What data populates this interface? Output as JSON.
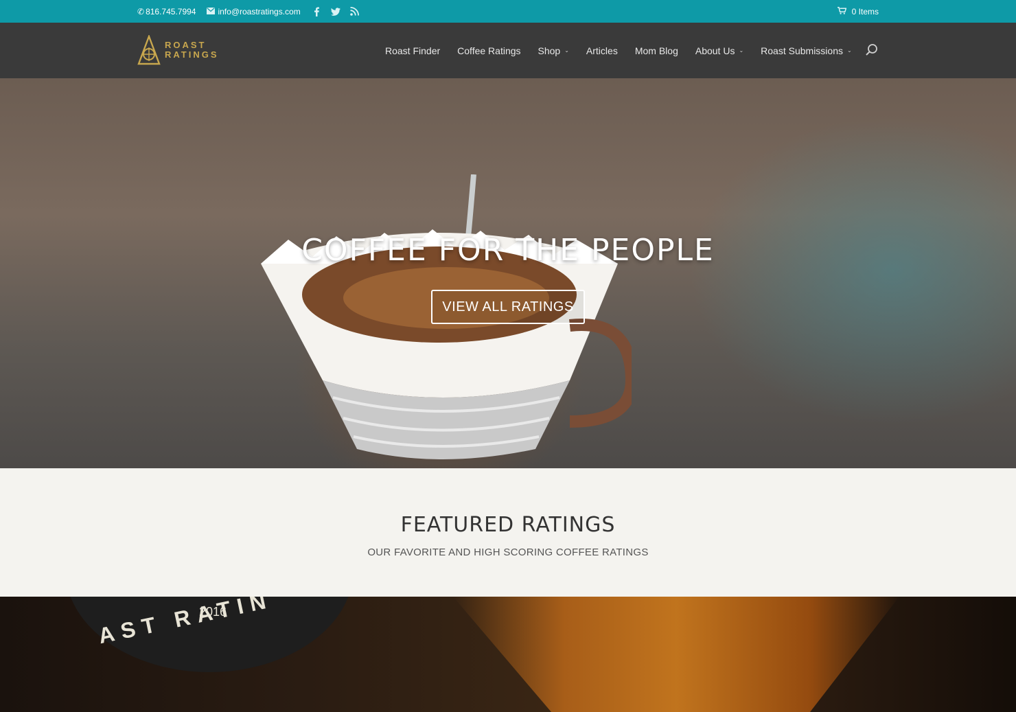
{
  "topbar": {
    "phone": "816.745.7994",
    "email": "info@roastratings.com",
    "social_icons": [
      "facebook-icon",
      "twitter-icon",
      "rss-icon"
    ],
    "cart": "0 Items"
  },
  "header": {
    "logo_line1": "ROAST",
    "logo_line2": "RATINGS",
    "nav": [
      {
        "label": "Roast Finder",
        "has_dropdown": false
      },
      {
        "label": "Coffee Ratings",
        "has_dropdown": false
      },
      {
        "label": "Shop",
        "has_dropdown": true
      },
      {
        "label": "Articles",
        "has_dropdown": false
      },
      {
        "label": "Mom Blog",
        "has_dropdown": false
      },
      {
        "label": "About Us",
        "has_dropdown": true
      },
      {
        "label": "Roast Submissions",
        "has_dropdown": true
      }
    ]
  },
  "hero": {
    "title": "COFFEE FOR THE PEOPLE",
    "button": "VIEW ALL RATINGS"
  },
  "featured": {
    "title": "FEATURED RATINGS",
    "subtitle": "OUR FAVORITE AND HIGH SCORING COFFEE RATINGS"
  },
  "bottom_badge": {
    "year": "2016",
    "text": "AST RATIN"
  },
  "colors": {
    "topbar": "#0e9aa7",
    "header": "#3a3a3a",
    "logo": "#c8a74e",
    "section_bg": "#f4f3ef"
  }
}
